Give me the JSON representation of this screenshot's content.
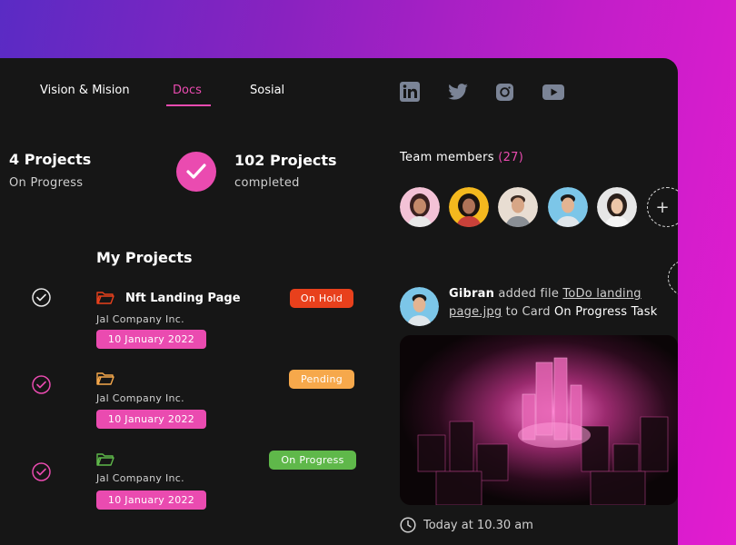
{
  "tabs": [
    {
      "label": "Vision & Mision",
      "active": false
    },
    {
      "label": "Docs",
      "active": true
    },
    {
      "label": "Sosial",
      "active": false
    }
  ],
  "social": [
    "linkedin-icon",
    "twitter-icon",
    "instagram-icon",
    "youtube-icon"
  ],
  "stats": {
    "progress": {
      "count": "4  Projects",
      "label": "On Progress"
    },
    "completed": {
      "count": "102 Projects",
      "label": "completed"
    }
  },
  "my_projects": {
    "title": "My Projects",
    "items": [
      {
        "name": "Nft Landing Page",
        "company": "Jal Company Inc.",
        "date": "10 January 2022",
        "status": "On Hold",
        "status_color": "#e8401c",
        "folder_color": "#e8401c"
      },
      {
        "name": "",
        "company": "Jal Company Inc.",
        "date": "10 January 2022",
        "status": "Pending",
        "status_color": "#f6a84b",
        "folder_color": "#f6a84b"
      },
      {
        "name": "",
        "company": "Jal Company Inc.",
        "date": "10 January 2022",
        "status": "On Progress",
        "status_color": "#5fb84a",
        "folder_color": "#5fb84a"
      }
    ]
  },
  "team": {
    "title": "Team members",
    "count": "(27)"
  },
  "activity": {
    "user": "Gibran",
    "action": " added file ",
    "file": "ToDo landing page.jpg",
    "to_card": " to Card ",
    "card": "On Progress Task",
    "time": "Today at 10.30 am"
  },
  "colors": {
    "accent": "#ea4bb0",
    "card_bg": "#161616"
  }
}
